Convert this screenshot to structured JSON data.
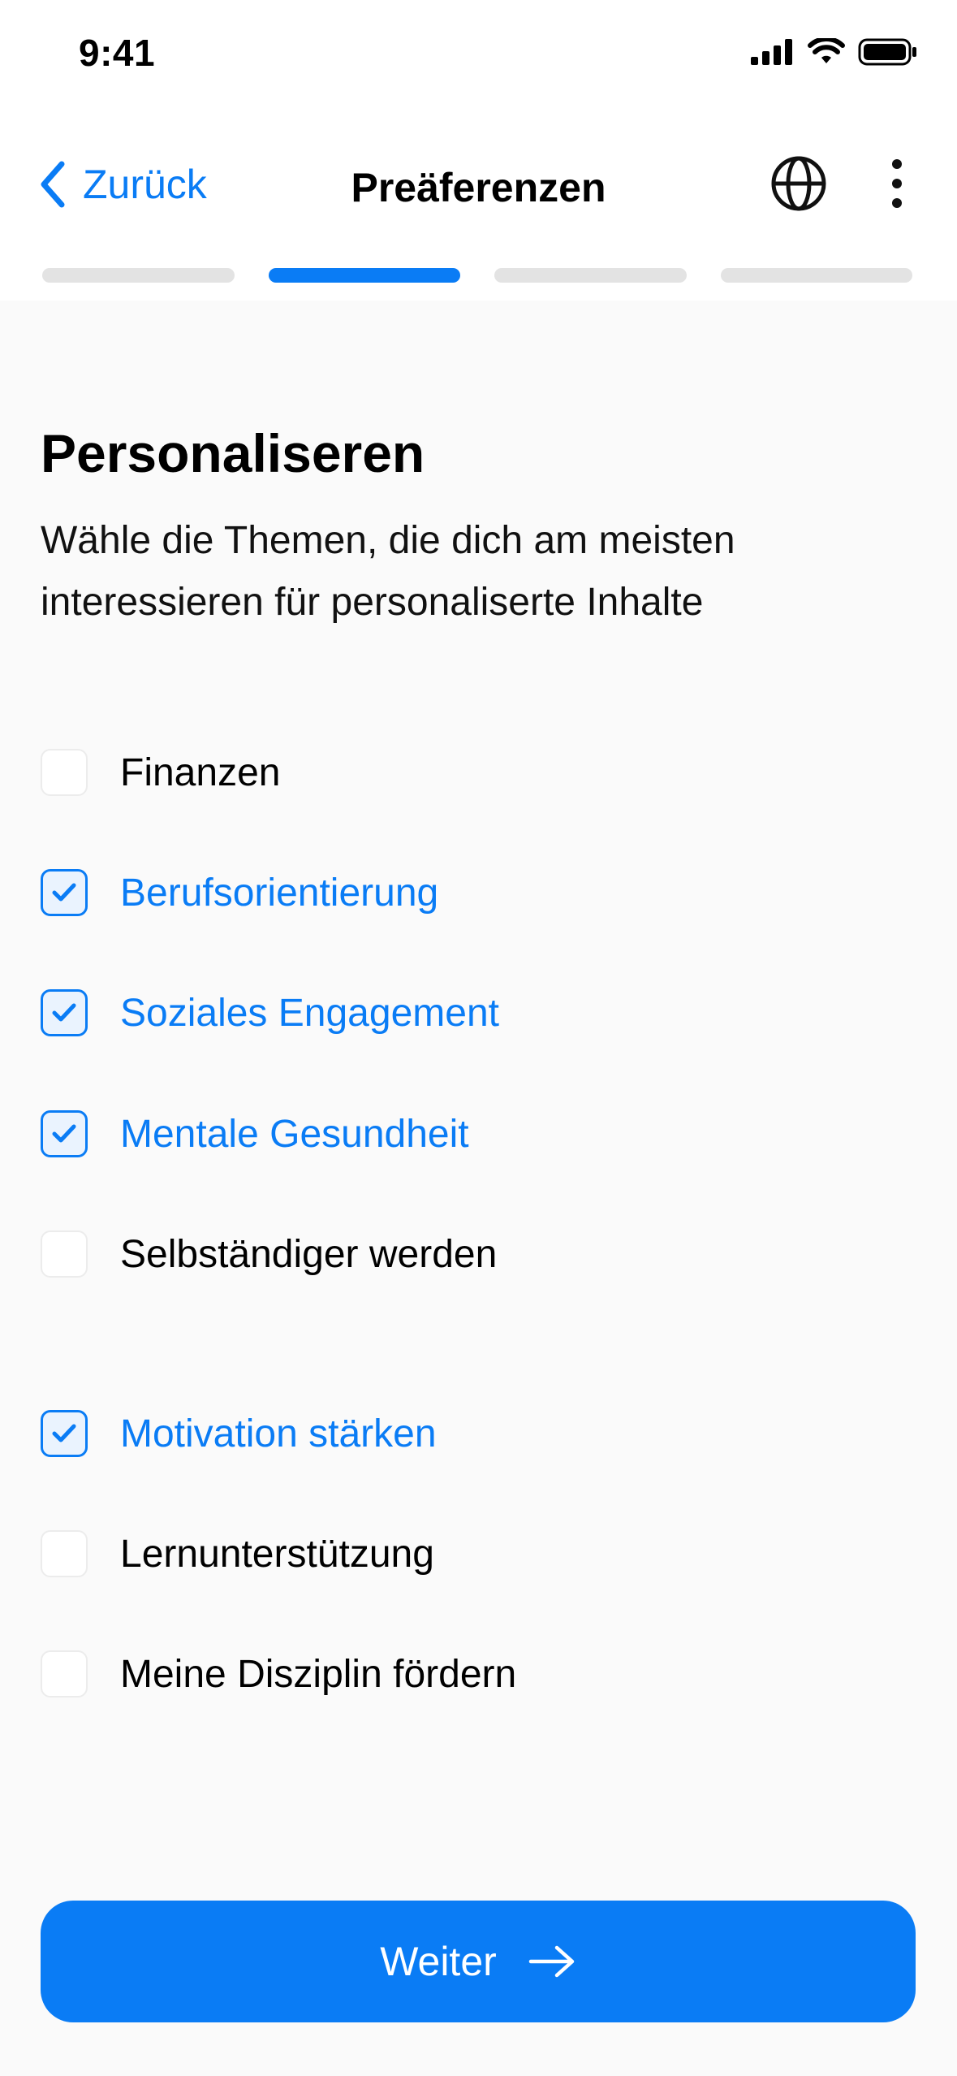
{
  "status": {
    "time": "9:41"
  },
  "nav": {
    "back_label": "Zurück",
    "title": "Preäferenzen"
  },
  "progress": {
    "total_steps": 4,
    "current_step": 2
  },
  "header": {
    "title": "Personaliseren",
    "subtitle": "Wähle die Themen, die dich am meisten interessieren für personaliserte Inhalte"
  },
  "options": [
    {
      "label": "Finanzen",
      "checked": false
    },
    {
      "label": "Berufsorientierung",
      "checked": true
    },
    {
      "label": "Soziales Engagement",
      "checked": true
    },
    {
      "label": "Mentale Gesundheit",
      "checked": true
    },
    {
      "label": "Selbständiger werden",
      "checked": false
    },
    {
      "label": "Motivation stärken",
      "checked": true
    },
    {
      "label": "Lernunterstützung",
      "checked": false
    },
    {
      "label": "Meine Disziplin fördern",
      "checked": false
    }
  ],
  "cta": {
    "label": "Weiter"
  },
  "colors": {
    "accent": "#0A7CF5",
    "inactive": "#E3E3E3"
  }
}
